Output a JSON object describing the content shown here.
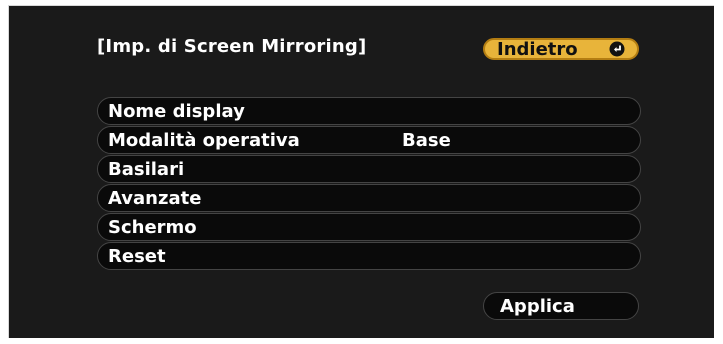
{
  "header": {
    "title": "[Imp. di Screen Mirroring]",
    "back_label": "Indietro"
  },
  "menu": {
    "items": [
      {
        "label": "Nome display",
        "value": ""
      },
      {
        "label": "Modalità operativa",
        "value": "Base"
      },
      {
        "label": "Basilari",
        "value": ""
      },
      {
        "label": "Avanzate",
        "value": ""
      },
      {
        "label": "Schermo",
        "value": ""
      },
      {
        "label": "Reset",
        "value": ""
      }
    ]
  },
  "footer": {
    "apply_label": "Applica"
  },
  "colors": {
    "background": "#1a1a1a",
    "highlight": "#e8b43a",
    "text": "#ffffff"
  }
}
